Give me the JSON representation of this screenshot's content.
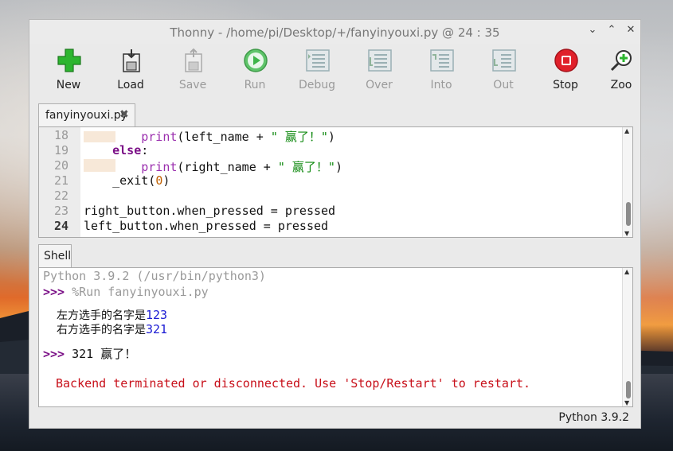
{
  "window": {
    "title": "Thonny  -  /home/pi/Desktop/+/fanyinyouxi.py  @  24 : 35"
  },
  "toolbar": [
    {
      "label": "New",
      "icon": "new-icon",
      "enabled": true
    },
    {
      "label": "Load",
      "icon": "load-icon",
      "enabled": true
    },
    {
      "label": "Save",
      "icon": "save-icon",
      "enabled": false
    },
    {
      "label": "Run",
      "icon": "run-icon",
      "enabled": false
    },
    {
      "label": "Debug",
      "icon": "debug-icon",
      "enabled": false
    },
    {
      "label": "Over",
      "icon": "step-over-icon",
      "enabled": false
    },
    {
      "label": "Into",
      "icon": "step-into-icon",
      "enabled": false
    },
    {
      "label": "Out",
      "icon": "step-out-icon",
      "enabled": false
    },
    {
      "label": "Stop",
      "icon": "stop-icon",
      "enabled": true
    },
    {
      "label": "Zoo",
      "icon": "zoom-icon",
      "enabled": true
    }
  ],
  "editor": {
    "tab_label": "fanyinyouxi.py",
    "lines": [
      {
        "num": "18",
        "indent": "        ",
        "fn": "print",
        "args_pre": "(left_name + ",
        "str": "\" 赢了！\"",
        "args_post": ")"
      },
      {
        "num": "19",
        "indent": "    ",
        "kw": "else",
        "post": ":"
      },
      {
        "num": "20",
        "indent": "        ",
        "fn": "print",
        "args_pre": "(right_name + ",
        "str": "\" 赢了！\"",
        "args_post": ")"
      },
      {
        "num": "21",
        "indent": "    ",
        "plain": "_exit(",
        "number": "0",
        "close": ")"
      },
      {
        "num": "22",
        "text": ""
      },
      {
        "num": "23",
        "text": "right_button.when_pressed = pressed"
      },
      {
        "num": "24",
        "text": "left_button.when_pressed = pressed"
      }
    ]
  },
  "shell": {
    "tab_label": "Shell",
    "banner": "Python 3.9.2 (/usr/bin/python3)",
    "prompt": ">>>",
    "run_cmd": "%Run fanyinyouxi.py",
    "out1_label": "左方选手的名字是",
    "out1_value": "123",
    "out2_label": "右方选手的名字是",
    "out2_value": "321",
    "input_line": "321 赢了！",
    "error": "Backend terminated or disconnected. Use 'Stop/Restart' to restart."
  },
  "status": {
    "python_version": "Python 3.9.2"
  },
  "colors": {
    "stop_red": "#e0202a",
    "run_green": "#3fb54a",
    "new_green": "#2db52f"
  }
}
